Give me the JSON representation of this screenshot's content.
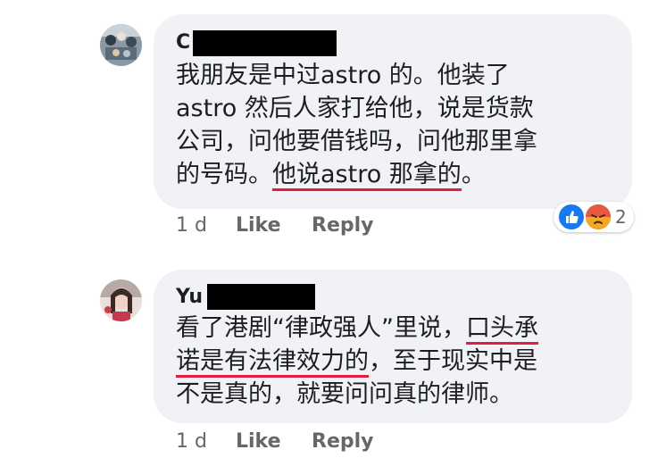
{
  "comments": [
    {
      "author_initial": "C",
      "text_lines": [
        "我朋友是中过astro 的。他装了",
        "astro 然后人家打给他，说是货款",
        "公司，问他要借钱吗，问他那里拿"
      ],
      "last_line_plain": "的号码。",
      "last_line_underlined": "他说astro 那拿的",
      "last_line_end": "。",
      "time": "1 d",
      "like_label": "Like",
      "reply_label": "Reply",
      "reaction_count": "2",
      "reaction_icons": [
        "like-icon",
        "angry-icon"
      ]
    },
    {
      "author_initial": "Yu",
      "line1_plain": "看了港剧“律政强人”里说，",
      "line1_underlined": "口头承",
      "line2_underlined": "诺是有法律效力的",
      "line2_plain": "，至于现实中是",
      "line3": "不是真的，就要问问真的律师。",
      "time": "1 d",
      "like_label": "Like",
      "reply_label": "Reply"
    }
  ],
  "colors": {
    "bubble": "#f0f2f5",
    "underline": "#e41e3f",
    "meta_text": "#65676b",
    "like_blue": "#1877f2",
    "angry_orange": "#f7714c"
  }
}
